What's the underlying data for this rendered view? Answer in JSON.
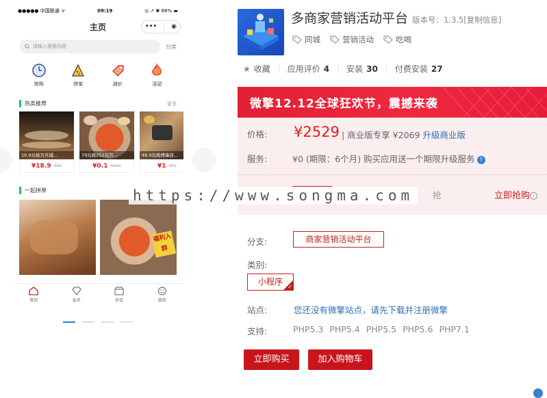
{
  "phone": {
    "status": {
      "carrier": "●●●●● 中国联通 ᯤ",
      "time": "09:19",
      "battery": "◎ ➚ ✱ 88% ▬"
    },
    "nav": {
      "title": "主页",
      "capsule_more": "•••",
      "capsule_close": "◉"
    },
    "search": {
      "placeholder": "请输入搜索内容",
      "category": "分类"
    },
    "categories": [
      {
        "label": "抢购",
        "icon": "clock-icon"
      },
      {
        "label": "拼单",
        "icon": "pizza-icon"
      },
      {
        "label": "减价",
        "icon": "price-tag-icon"
      },
      {
        "label": "活动",
        "icon": "flame-icon"
      }
    ],
    "hot": {
      "title": "热卖推荐",
      "more": "更多",
      "items": [
        {
          "caption": "19.9元抢万乐城...",
          "price": "¥18.9",
          "old": "¥58"
        },
        {
          "caption": "79元抢252元万...",
          "price": "¥0.1",
          "old": "¥262"
        },
        {
          "caption": "49.9元抢烤串店...",
          "price": "¥1",
          "old": "¥91"
        }
      ]
    },
    "group": {
      "title": "一起拼单",
      "sticker": "福利入群"
    },
    "tabs": [
      {
        "label": "首页",
        "icon": "home-icon"
      },
      {
        "label": "会员",
        "icon": "diamond-icon"
      },
      {
        "label": "好店",
        "icon": "store-icon"
      },
      {
        "label": "我的",
        "icon": "smile-icon"
      }
    ]
  },
  "product": {
    "name": "多商家营销活动平台",
    "version": "版本号：1.3.5[复制信息]",
    "tags": [
      "同城",
      "营销活动",
      "吃喝"
    ],
    "stats": {
      "fav_label": "收藏",
      "review_label": "应用评价",
      "review_count": "4",
      "install_label": "安装",
      "install_count": "30",
      "paid_label": "付费安装",
      "paid_count": "27"
    },
    "banner": "微擎12.12全球狂欢节，震撼来袭",
    "price_label": "价格:",
    "price": "¥2529",
    "price_detail_prefix": "| 商业版专享 ¥2069",
    "upgrade_link": "升级商业版",
    "service_label": "服务:",
    "service": "¥0 (期限：6个月)   购买应用送一个期限升级服务",
    "behind_text": "抢",
    "rush_text": "立即抢购",
    "watermark": "https://www.songma.com",
    "branch_label": "分支:",
    "branch": "商家营销活动平台",
    "type_label": "类别:",
    "type": "小程序",
    "site_label": "站点:",
    "site": "您还没有微擎站点，请先下载并注册微擎",
    "support_label": "支持:",
    "php": [
      "PHP5.3",
      "PHP5.4",
      "PHP5.5",
      "PHP5.6",
      "PHP7.1"
    ],
    "buy": "立即购买",
    "cart": "加入购物车"
  }
}
